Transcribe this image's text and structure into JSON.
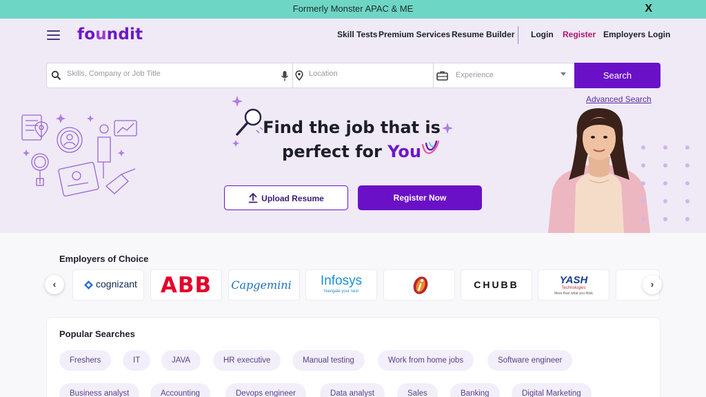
{
  "banner": {
    "text": "Formerly Monster APAC & ME",
    "close": "X"
  },
  "header": {
    "logo": {
      "pre": "fo",
      "u": "u",
      "post": "ndit"
    },
    "nav": {
      "skill_tests": "Skill Tests",
      "premium_services": "Premium Services",
      "resume_builder": "Resume Builder",
      "login": "Login",
      "register": "Register",
      "employers_login": "Employers Login"
    }
  },
  "search": {
    "keyword_placeholder": "Skills, Company or Job Title",
    "location_placeholder": "Location",
    "experience_placeholder": "Experience",
    "button": "Search",
    "advanced": "Advanced Search"
  },
  "hero": {
    "headline_line1": "Find the job that is",
    "headline_line2_pre": "perfect for ",
    "headline_line2_emph": "You",
    "upload_button": "Upload Resume",
    "register_button": "Register Now"
  },
  "employers": {
    "title": "Employers of Choice",
    "logos": [
      "cognizant",
      "ABB",
      "Capgemini",
      "Infosys",
      "Navigate your next",
      "CHUBB",
      "YASH",
      "Technologies",
      "More than what you think"
    ]
  },
  "popular": {
    "title": "Popular Searches",
    "row1": [
      "Freshers",
      "IT",
      "JAVA",
      "HR executive",
      "Manual testing",
      "Work from home jobs",
      "Software engineer"
    ],
    "row2": [
      "Business analyst",
      "Accounting",
      "Devops engineer",
      "Data analyst",
      "Sales",
      "Banking",
      "Digital Marketing"
    ]
  },
  "colors": {
    "brand": "#6a11c7",
    "banner": "#6ed6c5",
    "register_link": "#b0166d",
    "hero_bg": "#efeaf6"
  }
}
